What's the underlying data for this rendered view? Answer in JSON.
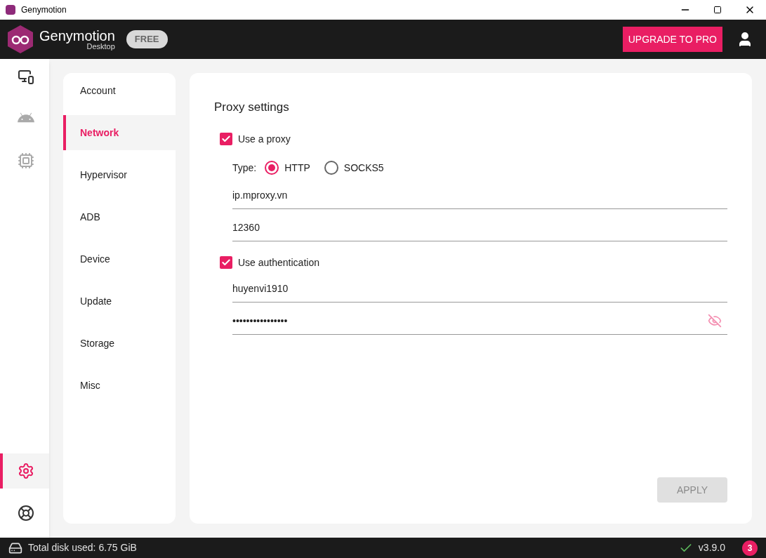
{
  "window": {
    "title": "Genymotion"
  },
  "header": {
    "brand": "Genymotion",
    "subtitle": "Desktop",
    "badge": "FREE",
    "upgrade_button": "UPGRADE TO PRO"
  },
  "rail": [
    {
      "kind": "devices",
      "selected": false
    },
    {
      "kind": "android",
      "selected": false
    },
    {
      "kind": "chip",
      "selected": false
    },
    {
      "kind": "settings",
      "selected": true
    },
    {
      "kind": "help",
      "selected": false
    }
  ],
  "settings_nav": [
    {
      "label": "Account",
      "selected": false
    },
    {
      "label": "Network",
      "selected": true
    },
    {
      "label": "Hypervisor",
      "selected": false
    },
    {
      "label": "ADB",
      "selected": false
    },
    {
      "label": "Device",
      "selected": false
    },
    {
      "label": "Update",
      "selected": false
    },
    {
      "label": "Storage",
      "selected": false
    },
    {
      "label": "Misc",
      "selected": false
    }
  ],
  "proxy": {
    "title": "Proxy settings",
    "use_proxy": {
      "label": "Use a proxy",
      "checked": true
    },
    "type_label": "Type:",
    "types": [
      {
        "label": "HTTP",
        "selected": true
      },
      {
        "label": "SOCKS5",
        "selected": false
      }
    ],
    "host": "ip.mproxy.vn",
    "port": "12360",
    "use_auth": {
      "label": "Use authentication",
      "checked": true
    },
    "username": "huyenvi1910",
    "password": "••••••••••••••••",
    "apply": {
      "label": "APPLY",
      "disabled": true
    }
  },
  "status_bar": {
    "disk": "Total disk used: 6.75 GiB",
    "version": "v3.9.0",
    "notification_count": "3"
  }
}
